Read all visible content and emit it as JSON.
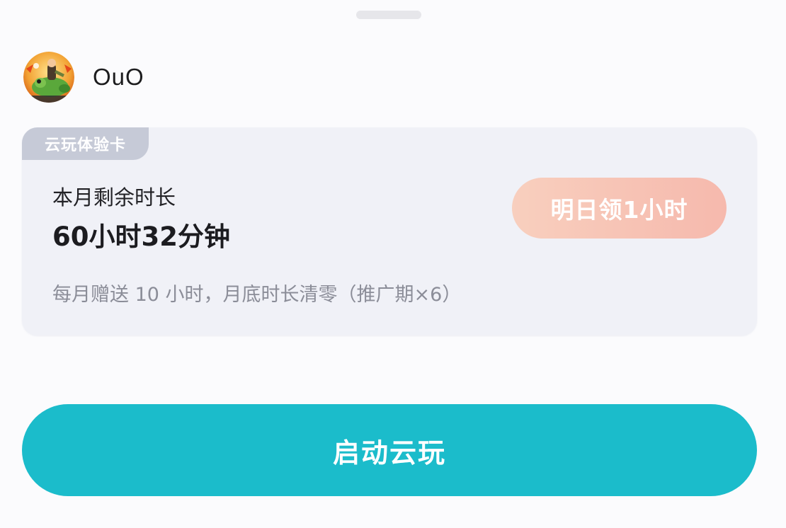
{
  "user": {
    "name": "OuO"
  },
  "card": {
    "tag": "云玩体验卡",
    "remaining_label": "本月剩余时长",
    "remaining_value": "60小时32分钟",
    "claim_button": "明日领1小时",
    "note": "每月赠送 10 小时，月底时长清零（推广期×6）"
  },
  "actions": {
    "launch_button": "启动云玩"
  },
  "colors": {
    "background": "#fbfbfd",
    "card_background": "#f0f1f7",
    "tag_background": "#c6cad7",
    "claim_button_gradient_start": "#f8cfbe",
    "claim_button_gradient_end": "#f6b9ad",
    "launch_button": "#1bbccb"
  },
  "icons": {
    "avatar": "cartoon-frog-avatar"
  }
}
